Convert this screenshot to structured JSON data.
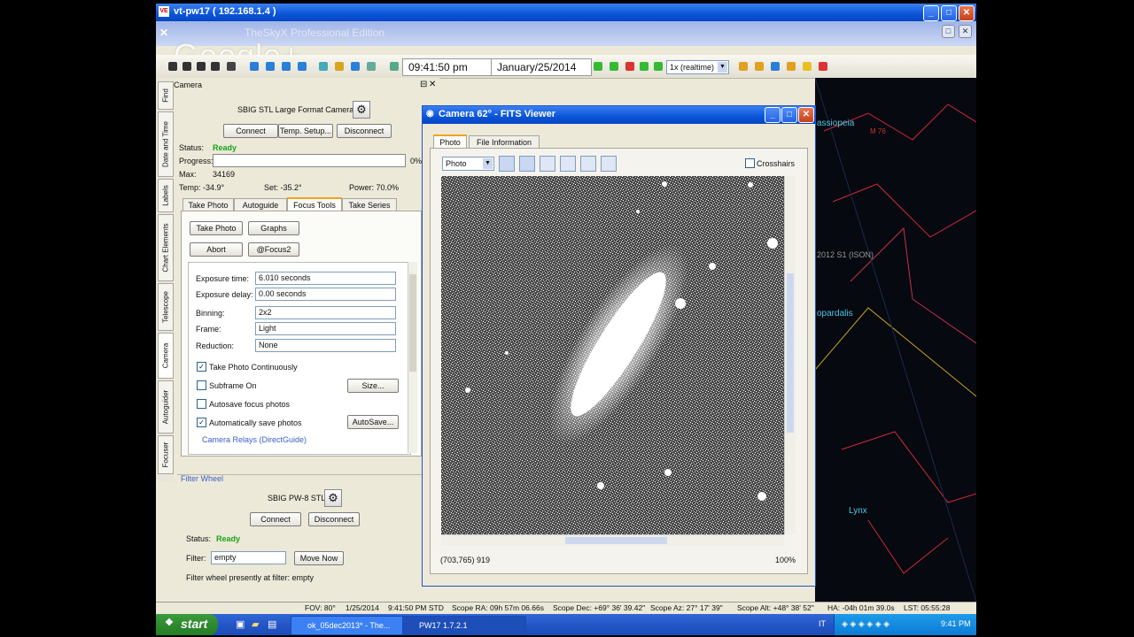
{
  "window": {
    "title": "vt-pw17 ( 192.168.1.4 )",
    "app_icon": "VE"
  },
  "overlay": {
    "brand": "Google+",
    "edition": "TheSkyX Professional Edition"
  },
  "toolbar": {
    "time": "09:41:50 pm",
    "date": "January/25/2014",
    "rate": "1x (realtime)"
  },
  "side_tabs": [
    "Find",
    "Date and Time",
    "Labels",
    "Chart Elements",
    "Telescope",
    "Camera",
    "Autoguider",
    "Focuser"
  ],
  "camera_panel": {
    "title": "Camera",
    "camera_name": "SBIG STL Large Format Cameras",
    "connect": "Connect",
    "temp_setup": "Temp. Setup...",
    "disconnect": "Disconnect",
    "status_label": "Status:",
    "status_value": "Ready",
    "progress_label": "Progress:",
    "progress_pct": "0%",
    "progress_fraction": 0.0,
    "max_label": "Max:",
    "max_value": "34169",
    "temp": "Temp: -34.9°",
    "set": "Set: -35.2°",
    "power": "Power: 70.0%",
    "tabs": [
      "Take Photo",
      "Autoguide",
      "Focus Tools",
      "Take Series"
    ],
    "take_photo": "Take Photo",
    "graphs": "Graphs",
    "abort": "Abort",
    "focus2": "@Focus2",
    "exposure_time_label": "Exposure time:",
    "exposure_time": "6.010 seconds",
    "exposure_delay_label": "Exposure delay:",
    "exposure_delay": "0.00 seconds",
    "binning_label": "Binning:",
    "binning": "2x2",
    "frame_label": "Frame:",
    "frame": "Light",
    "reduction_label": "Reduction:",
    "reduction": "None",
    "take_continuously": "Take Photo Continuously",
    "subframe": "Subframe On",
    "size_btn": "Size...",
    "autosave_focus": "Autosave focus photos",
    "auto_save": "Automatically save photos",
    "autosave_btn": "AutoSave...",
    "relays": "Camera Relays (DirectGuide)"
  },
  "filter_panel": {
    "title": "Filter Wheel",
    "name": "SBIG PW-8 STL",
    "connect": "Connect",
    "disconnect": "Disconnect",
    "status_label": "Status:",
    "status_value": "Ready",
    "filter_label": "Filter:",
    "filter_value": "empty",
    "move_now": "Move Now",
    "message": "Filter wheel presently at filter:  empty"
  },
  "fits": {
    "title": "Camera 62° - FITS Viewer",
    "tabs": [
      "Photo",
      "File Information"
    ],
    "view_select": "Photo",
    "crosshairs": "Crosshairs",
    "coords": "(703,765) 919",
    "zoom": "100%"
  },
  "sky_labels": [
    "assiopeia",
    "2012 S1 (ISON)",
    "opardalis",
    "Lynx",
    "M 76"
  ],
  "status_bar": {
    "fov": "FOV: 80°",
    "date": "1/25/2014",
    "time": "9:41:50 PM STD",
    "ra": "Scope RA: 09h 57m 06.66s",
    "dec": "Scope Dec: +69° 36' 39.42\"",
    "az": "Scope Az: 27° 17' 39\"",
    "alt": "Scope Alt: +48° 38' 52\"",
    "ha": "HA: -04h 01m 39.0s",
    "lst": "LST: 05:55:28"
  },
  "taskbar": {
    "start": "start",
    "task1": "ok_05dec2013* - The...",
    "task2": "PW17 1.7.2.1",
    "clock": "9:41 PM",
    "lang": "IT"
  }
}
